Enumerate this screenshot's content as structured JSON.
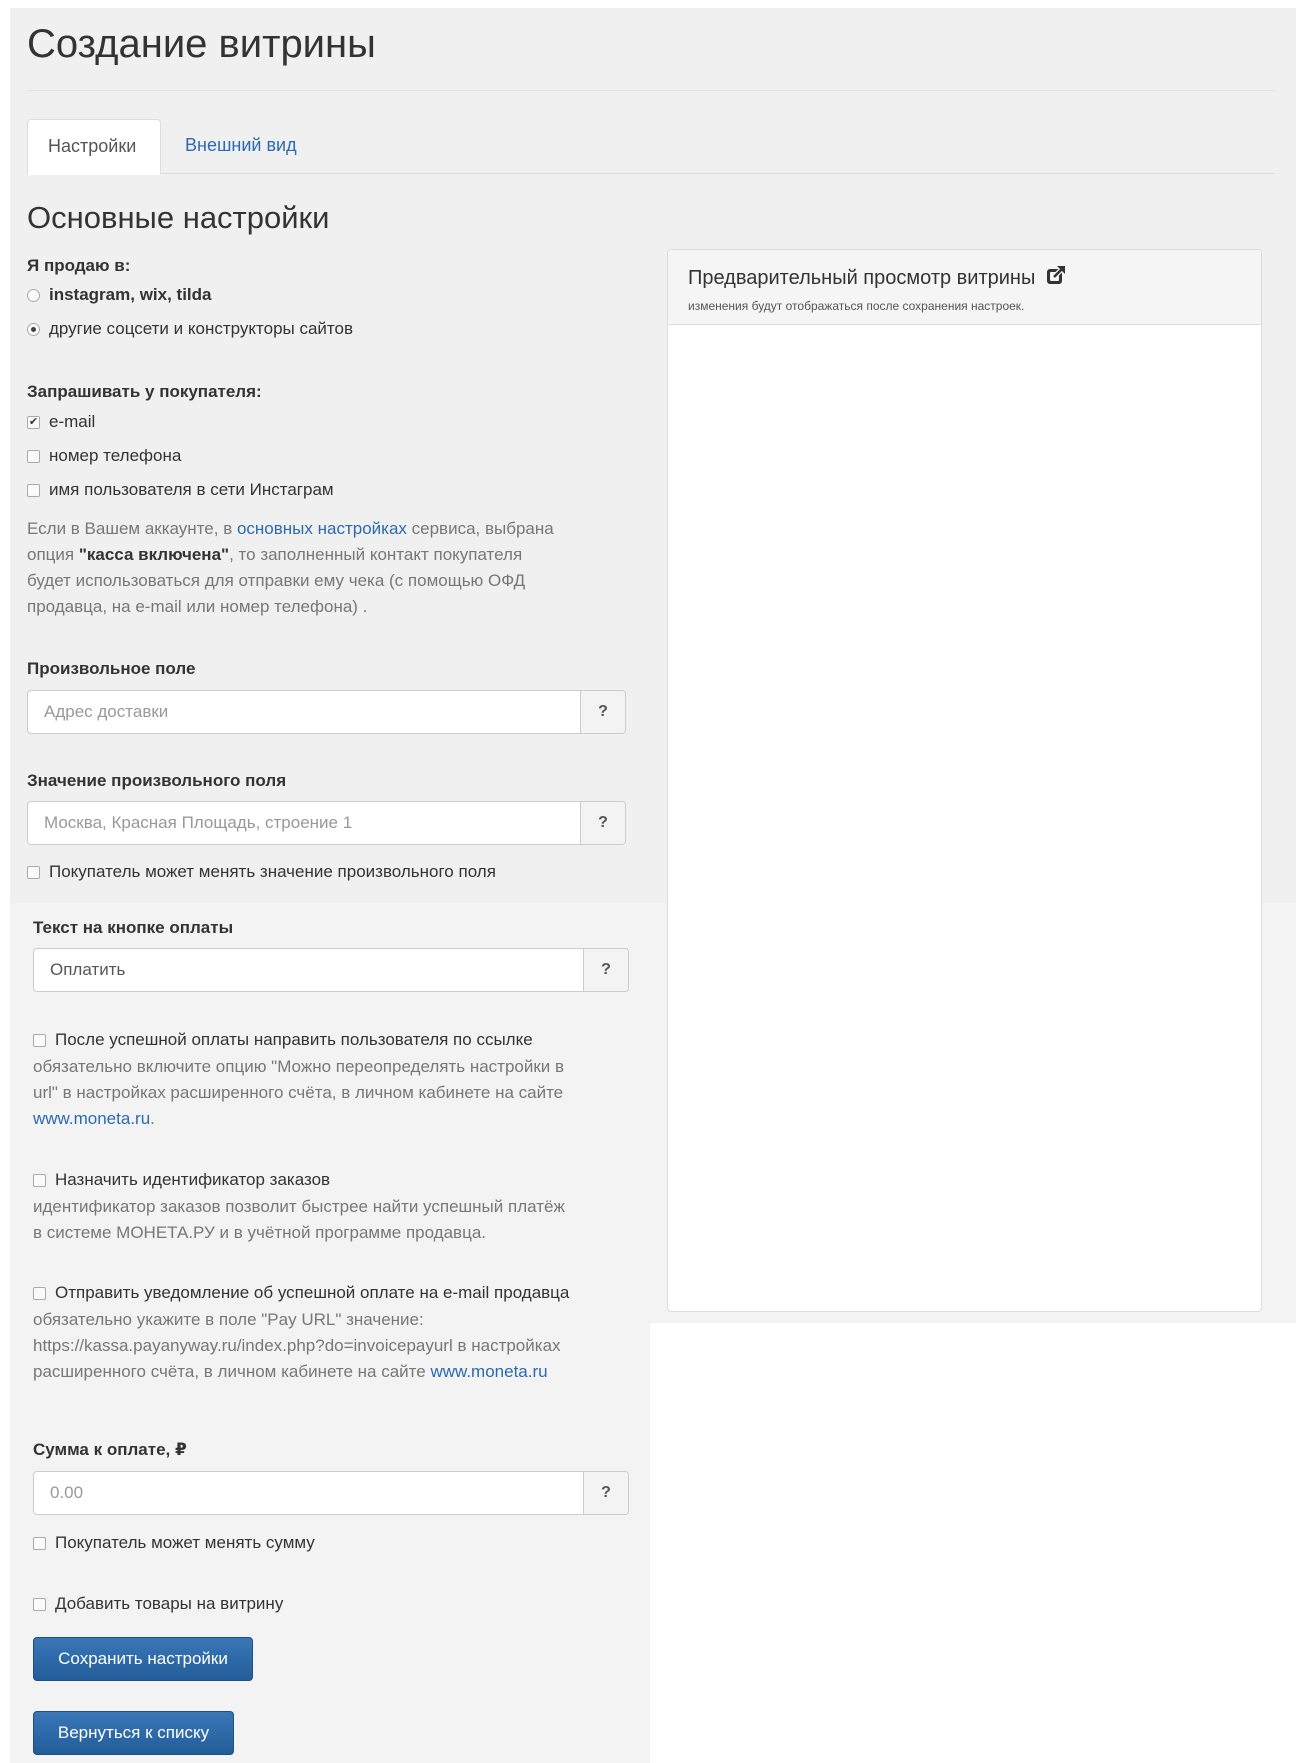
{
  "page": {
    "title": "Создание витрины"
  },
  "tabs": [
    {
      "label": "Настройки",
      "active": true
    },
    {
      "label": "Внешний вид",
      "active": false
    }
  ],
  "section_title": "Основные настройки",
  "sell_in": {
    "label": "Я продаю в:",
    "options": [
      {
        "label": "instagram, wix, tilda",
        "checked": false
      },
      {
        "label": "другие соцсети и конструкторы сайтов",
        "checked": true
      }
    ]
  },
  "ask_buyer": {
    "label": "Запрашивать у покупателя:",
    "options": [
      {
        "label": "e-mail",
        "checked": true
      },
      {
        "label": "номер телефона",
        "checked": false
      },
      {
        "label": "имя пользователя в сети Инстаграм",
        "checked": false
      }
    ],
    "note": {
      "p1": "Если в Вашем аккаунте, в ",
      "link": "основных настройках",
      "p2": " сервиса, выбрана",
      "p3": "опция ",
      "bold": "\"касса включена\"",
      "p4": ", то заполненный контакт покупателя",
      "line3": "будет использоваться для отправки ему чека (с помощью ОФД",
      "line4": "продавца, на e-mail или номер телефона) ."
    }
  },
  "custom_field": {
    "label": "Произвольное поле",
    "placeholder": "Адрес доставки",
    "help": "?"
  },
  "custom_value": {
    "label": "Значение произвольного поля",
    "placeholder": "Москва, Красная Площадь, строение 1",
    "help": "?",
    "checkbox": "Покупатель может менять значение произвольного поля"
  },
  "pay_button_text": {
    "label": "Текст на кнопке оплаты",
    "value": "Оплатить",
    "help": "?"
  },
  "redirect": {
    "checkbox": "После успешной оплаты направить пользователя по ссылке",
    "line1": "обязательно включите опцию \"Можно переопределять настройки в",
    "line2": "url\" в настройках расширенного счёта, в личном кабинете на сайте",
    "link": "www.moneta.ru",
    "after_link": "."
  },
  "order_id": {
    "checkbox": "Назначить идентификатор заказов",
    "line1": "идентификатор заказов позволит быстрее найти успешный платёж",
    "line2": "в системе МОНЕТА.РУ и в учётной программе продавца."
  },
  "notify": {
    "checkbox": "Отправить уведомление об успешной оплате на e-mail продавца",
    "line1": "обязательно укажите в поле \"Pay URL\" значение:",
    "line2": "https://kassa.payanyway.ru/index.php?do=invoicepayurl в настройках",
    "line3": "расширенного счёта, в личном кабинете на сайте ",
    "link": "www.moneta.ru"
  },
  "amount": {
    "label": "Сумма к оплате, ₽",
    "placeholder": "0.00",
    "help": "?",
    "checkbox": "Покупатель может менять сумму"
  },
  "add_products": "Добавить товары на витрину",
  "buttons": {
    "save": "Сохранить настройки",
    "back": "Вернуться к списку"
  },
  "preview": {
    "title": "Предварительный просмотр витрины",
    "note": "изменения будут отображаться после сохранения настроек."
  }
}
